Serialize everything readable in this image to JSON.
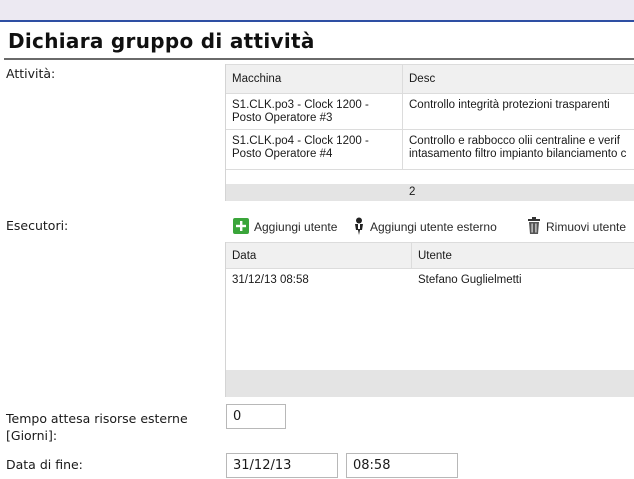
{
  "title": "Dichiara gruppo di attività",
  "labels": {
    "attivita": "Attività:",
    "esecutori": "Esecutori:",
    "tempo_attesa": "Tempo attesa risorse esterne\n[Giorni]:",
    "data_fine": "Data di fine:"
  },
  "activities": {
    "columns": [
      "Macchina",
      "Desc"
    ],
    "rows": [
      {
        "macchina": "S1.CLK.po3 - Clock 1200 -\nPosto Operatore #3",
        "desc": "Controllo integrità protezioni trasparenti"
      },
      {
        "macchina": "S1.CLK.po4 - Clock 1200 -\nPosto Operatore #4",
        "desc": "Controllo e rabbocco olii centraline e verif\nintasamento filtro impianto bilanciamento c"
      }
    ],
    "footer_count": "2"
  },
  "toolbar": {
    "add_user": "Aggiungi utente",
    "add_external_user": "Aggiungi utente esterno",
    "remove_user": "Rimuovi utente"
  },
  "executors": {
    "columns": [
      "Data",
      "Utente"
    ],
    "rows": [
      {
        "data": "31/12/13 08:58",
        "utente": "Stefano Guglielmetti"
      }
    ]
  },
  "fields": {
    "tempo_attesa_value": "0",
    "data_fine_date": "31/12/13",
    "data_fine_time": "08:58"
  },
  "colors": {
    "accent_border": "#2e4fa3",
    "add_icon_green": "#3aa53a"
  },
  "icons": {
    "add_user": "plus-icon",
    "add_external_user": "person-icon",
    "remove_user": "trash-icon"
  }
}
